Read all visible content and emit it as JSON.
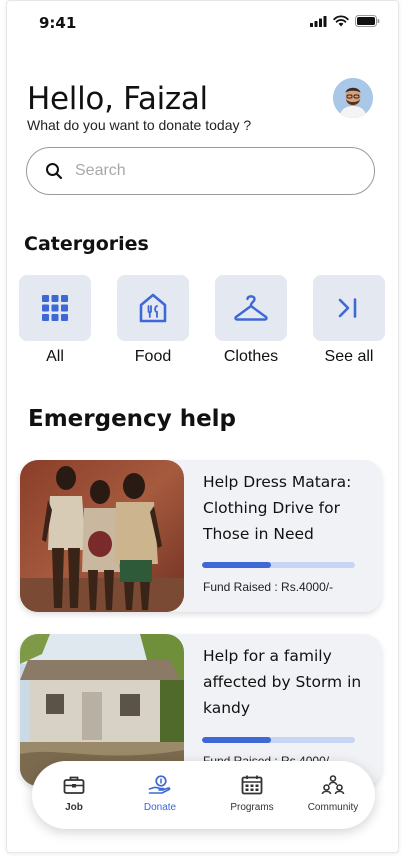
{
  "status_bar": {
    "time": "9:41"
  },
  "header": {
    "greeting": "Hello, Faizal",
    "subtitle": "What do you want to donate today ?"
  },
  "search": {
    "placeholder": "Search",
    "icon": "search-icon"
  },
  "categories": {
    "title": "Catergories",
    "items": [
      {
        "label": "All",
        "icon": "grid-icon"
      },
      {
        "label": "Food",
        "icon": "food-store-icon"
      },
      {
        "label": "Clothes",
        "icon": "hanger-icon"
      },
      {
        "label": "See all",
        "icon": "skip-forward-icon"
      }
    ]
  },
  "emergency": {
    "title": "Emergency help",
    "cards": [
      {
        "title": "Help Dress Matara: Clothing Drive for Those in Need",
        "fund_raised": "Fund Raised : Rs.4000/-",
        "progress": 0.45
      },
      {
        "title": "Help for a family affected by Storm in kandy",
        "fund_raised": "Fund Raised : Rs.4000/-",
        "progress": 0.45
      }
    ]
  },
  "bottom_nav": {
    "items": [
      {
        "label": "Job",
        "icon": "briefcase-icon",
        "active": false
      },
      {
        "label": "Donate",
        "icon": "donate-hand-icon",
        "active": true
      },
      {
        "label": "Programs",
        "icon": "calendar-icon",
        "active": false
      },
      {
        "label": "Community",
        "icon": "community-icon",
        "active": false
      }
    ]
  },
  "colors": {
    "accent": "#3e68d6",
    "category_bg": "#e4e8f0",
    "card_bg": "#f1f2f5",
    "progress_track": "#c8d4f4"
  }
}
